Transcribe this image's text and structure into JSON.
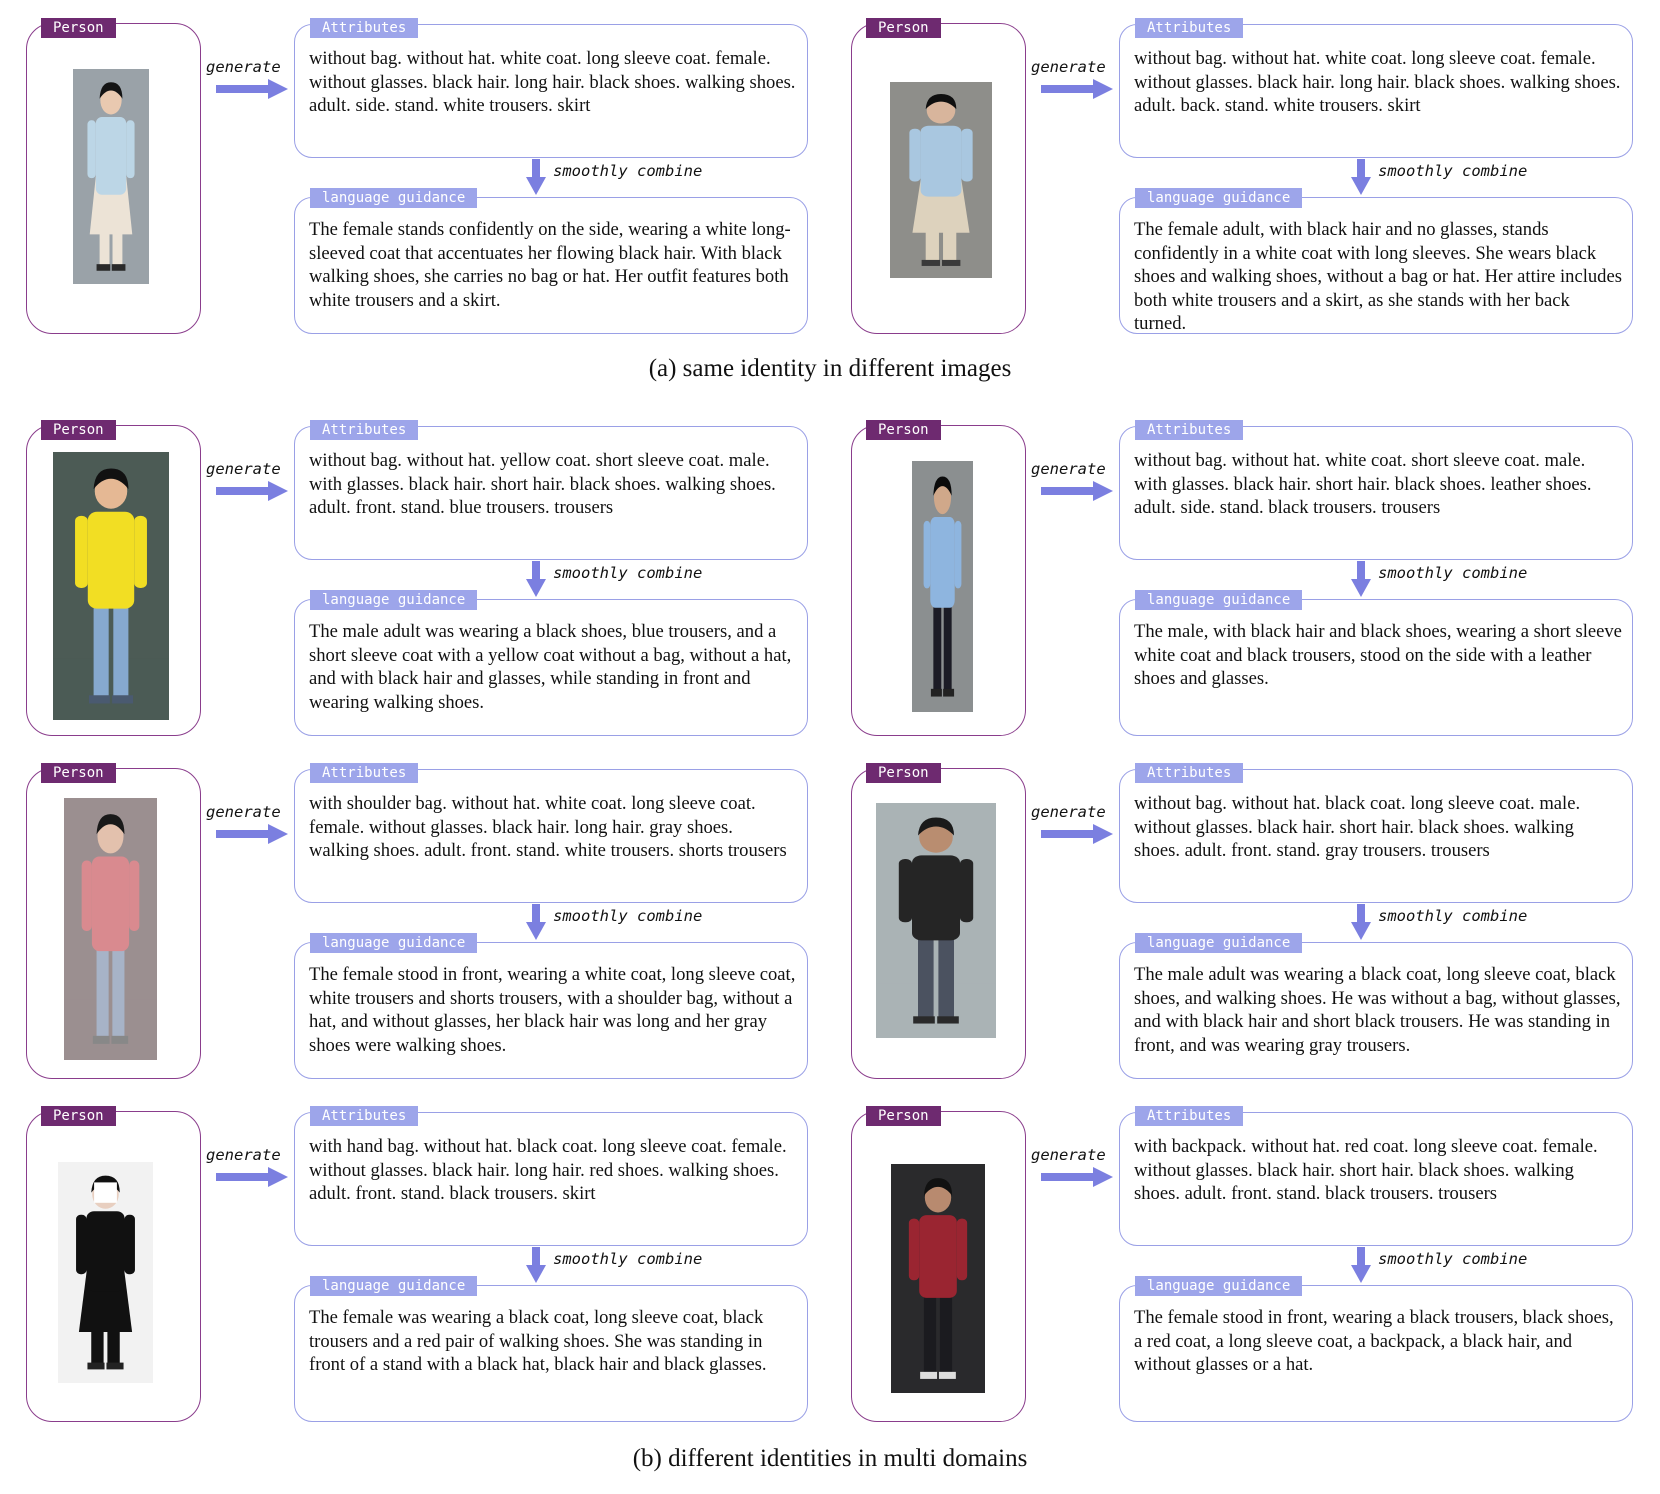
{
  "colors": {
    "person_border": "#8a3d8c",
    "person_tag_bg": "#6e2a70",
    "text_box_border": "#9aa0e6",
    "tag_bg": "#9da5ea",
    "arrow": "#7b7fe0"
  },
  "labels": {
    "person_tag": "Person",
    "attributes_tag": "Attributes",
    "guidance_tag": "language guidance",
    "generate": "generate",
    "combine": "smoothly combine"
  },
  "captions": {
    "a": "(a) same identity in different images",
    "b": "(b) different identities in multi domains"
  },
  "panels": [
    {
      "attributes": "without bag. without hat. white coat. long sleeve coat. female. without glasses. black hair. long hair. black shoes. walking shoes. adult. side. stand. white trousers. skirt",
      "guidance": "The female stands confidently on the side, wearing a white long-sleeved coat that accentuates her flowing black hair. With black walking shoes, she carries no bag or hat. Her outfit features both white trousers and a skirt."
    },
    {
      "attributes": "without bag. without hat. white coat. long sleeve coat. female. without glasses. black hair. long hair. black shoes. walking shoes. adult. back. stand. white trousers. skirt",
      "guidance": "The female adult, with black hair and no glasses, stands confidently in a white coat with long sleeves. She wears black shoes and walking shoes, without a bag or hat. Her attire includes both white trousers and a skirt, as she stands with her back turned."
    },
    {
      "attributes": "without bag. without hat. yellow coat. short sleeve coat. male. with glasses. black hair. short hair. black shoes. walking shoes. adult. front. stand. blue trousers. trousers",
      "guidance": "The male adult was wearing a black shoes, blue trousers, and a short sleeve coat with a yellow coat without a bag, without a hat, and with black hair and glasses, while standing in front and wearing walking shoes."
    },
    {
      "attributes": "without bag. without hat. white coat. short sleeve coat. male. with glasses. black hair. short hair. black shoes. leather shoes. adult. side. stand. black trousers. trousers",
      "guidance": "The male, with black hair and black shoes, wearing a short sleeve white coat and black trousers, stood on the side with a leather shoes and glasses."
    },
    {
      "attributes": "with shoulder bag. without hat. white coat. long sleeve coat. female. without glasses. black hair. long hair. gray shoes. walking shoes. adult. front. stand. white trousers. shorts trousers",
      "guidance": "The female stood in front, wearing a white coat, long sleeve coat, white trousers and shorts trousers, with a shoulder bag, without a hat, and without glasses, her black hair was long and her gray shoes were walking shoes."
    },
    {
      "attributes": "without bag. without hat. black coat. long sleeve coat. male. without glasses. black hair. short hair. black shoes. walking shoes. adult. front. stand. gray trousers. trousers",
      "guidance": "The male adult was wearing a black coat, long sleeve coat, black shoes, and walking shoes. He was without a bag, without glasses, and with black hair and short black trousers. He was standing in front, and was wearing gray trousers."
    },
    {
      "attributes": "with hand bag. without hat. black coat. long sleeve coat. female. without glasses. black hair. long hair. red shoes. walking shoes. adult. front. stand. black trousers. skirt",
      "guidance": "The female was wearing a black coat, long sleeve coat, black trousers and a red pair of walking shoes. She was standing in front of a stand with a black hat, black hair and black glasses."
    },
    {
      "attributes": "with backpack. without hat. red coat. long sleeve coat. female. without glasses. black hair. short hair. black shoes. walking shoes. adult. front. stand. black trousers. trousers",
      "guidance": "The female stood in front, wearing a black trousers, black shoes, a red coat, a long sleeve coat, a backpack, a black hair, and without glasses or a hat."
    }
  ]
}
